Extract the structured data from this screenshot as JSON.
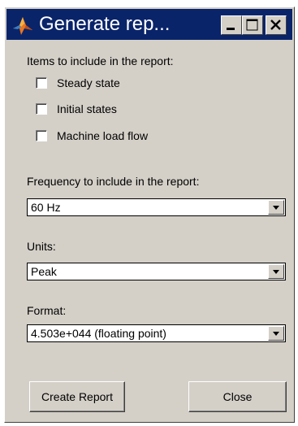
{
  "window": {
    "title": "Generate rep...",
    "controls": {
      "minimize_icon": "minimize-icon",
      "maximize_icon": "maximize-icon",
      "close_icon": "close-icon"
    }
  },
  "items_section": {
    "label": "Items to include in the report:",
    "checkboxes": [
      {
        "label": "Steady state",
        "checked": false
      },
      {
        "label": "Initial states",
        "checked": false
      },
      {
        "label": "Machine load flow",
        "checked": false
      }
    ]
  },
  "frequency": {
    "label": "Frequency to include in the report:",
    "selected": "60 Hz"
  },
  "units": {
    "label": "Units:",
    "selected": "Peak"
  },
  "format": {
    "label": "Format:",
    "selected": "4.503e+044 (floating point)"
  },
  "buttons": {
    "create_report": "Create Report",
    "close": "Close"
  },
  "colors": {
    "titlebar": "#0a246a",
    "window_face": "#d4d0c8",
    "title_text": "#ffffff"
  }
}
